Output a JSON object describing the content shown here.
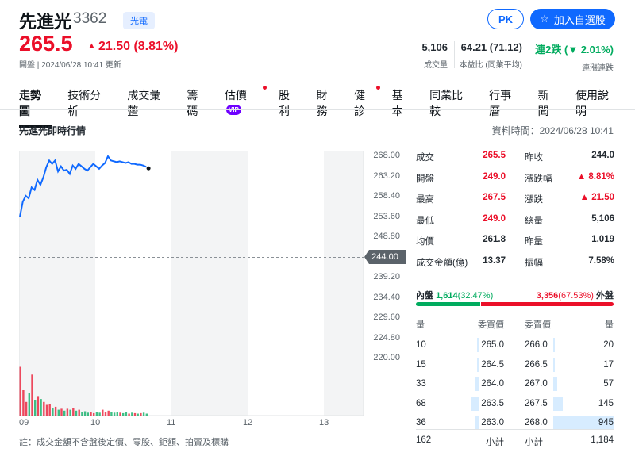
{
  "stock": {
    "name": "先進光",
    "code": "3362",
    "industry_tag": "光電",
    "price": "265.5",
    "change": "21.50 (8.81%)",
    "meta": "開盤 | 2024/06/28 10:41 更新"
  },
  "buttons": {
    "pk": "PK",
    "add_watchlist": "加入自選股"
  },
  "kpis": [
    {
      "value": "5,106",
      "label": "成交量"
    },
    {
      "value": "64.21 (71.12)",
      "label": "本益比 (同業平均)"
    },
    {
      "value": "連2跌 (▼ 2.01%)",
      "label": "連漲連跌"
    }
  ],
  "tabs": [
    {
      "label": "走勢圖",
      "active": true
    },
    {
      "label": "技術分析"
    },
    {
      "label": "成交彙整"
    },
    {
      "label": "籌碼"
    },
    {
      "label": "估價",
      "badge": "VIP",
      "dot": true
    },
    {
      "label": "股利"
    },
    {
      "label": "財務"
    },
    {
      "label": "健診",
      "dot": true
    },
    {
      "label": "基本"
    },
    {
      "label": "同業比較"
    },
    {
      "label": "行事曆"
    },
    {
      "label": "新聞"
    },
    {
      "label": "使用說明"
    }
  ],
  "section": {
    "title": "先進光即時行情",
    "data_time": "資料時間：2024/06/28 10:41"
  },
  "chart_data": {
    "type": "line",
    "y_ticks": [
      "268.00",
      "263.20",
      "258.40",
      "253.60",
      "248.80",
      "244.00",
      "239.20",
      "234.40",
      "229.60",
      "224.80",
      "220.00"
    ],
    "ylim": [
      220.0,
      268.0
    ],
    "reference_price": 244.0,
    "reference_label": "244.00",
    "x_ticks": [
      "09",
      "10",
      "11",
      "12",
      "13"
    ],
    "price_series": [
      253.6,
      257.2,
      258.6,
      258.0,
      260.6,
      260.0,
      262.4,
      261.2,
      263.0,
      265.4,
      267.0,
      266.2,
      267.0,
      264.4,
      265.6,
      264.6,
      264.8,
      263.8,
      265.8,
      265.0,
      266.2,
      265.6,
      265.0,
      264.6,
      265.4,
      266.2,
      265.6,
      265.0,
      265.8,
      266.4,
      268.0,
      267.0,
      266.8,
      266.6,
      266.8,
      266.6,
      266.4,
      266.6,
      266.2,
      266.2,
      266.0,
      266.0,
      265.8,
      265.5
    ],
    "volume_series": [
      500,
      260,
      140,
      230,
      420,
      160,
      200,
      170,
      140,
      110,
      120,
      80,
      90,
      60,
      70,
      50,
      70,
      60,
      80,
      50,
      60,
      40,
      45,
      30,
      40,
      25,
      35,
      30,
      60,
      40,
      50,
      35,
      30,
      40,
      30,
      25,
      35,
      20,
      30,
      25,
      20,
      25,
      30,
      20
    ],
    "volume_max": 520
  },
  "stats": {
    "left": [
      {
        "label": "成交",
        "value": "265.5",
        "color": "#eb0f29"
      },
      {
        "label": "開盤",
        "value": "249.0",
        "color": "#eb0f29"
      },
      {
        "label": "最高",
        "value": "267.5",
        "color": "#eb0f29"
      },
      {
        "label": "最低",
        "value": "249.0",
        "color": "#eb0f29"
      },
      {
        "label": "均價",
        "value": "261.8",
        "color": "#232a31"
      },
      {
        "label": "成交金額(億)",
        "value": "13.37",
        "color": "#232a31"
      }
    ],
    "right": [
      {
        "label": "昨收",
        "value": "244.0",
        "color": "#232a31"
      },
      {
        "label": "漲跌幅",
        "value": "▲ 8.81%",
        "color": "#eb0f29"
      },
      {
        "label": "漲跌",
        "value": "▲ 21.50",
        "color": "#eb0f29"
      },
      {
        "label": "總量",
        "value": "5,106",
        "color": "#232a31"
      },
      {
        "label": "昨量",
        "value": "1,019",
        "color": "#232a31"
      },
      {
        "label": "振幅",
        "value": "7.58%",
        "color": "#232a31"
      }
    ]
  },
  "orderbook": {
    "inner_label": "內盤",
    "inner_value": "1,614",
    "inner_pct": "(32.47%)",
    "inner_fraction": 0.3247,
    "outer_value": "3,356",
    "outer_pct": "(67.53%)",
    "outer_label": "外盤",
    "headers": [
      "量",
      "委買價",
      "委賣價",
      "量"
    ],
    "bids": [
      {
        "qty": "10",
        "price": "265.0",
        "qty_num": 10
      },
      {
        "qty": "15",
        "price": "264.5",
        "qty_num": 15
      },
      {
        "qty": "33",
        "price": "264.0",
        "qty_num": 33
      },
      {
        "qty": "68",
        "price": "263.5",
        "qty_num": 68
      },
      {
        "qty": "36",
        "price": "263.0",
        "qty_num": 36
      }
    ],
    "asks": [
      {
        "price": "266.0",
        "qty": "20",
        "qty_num": 20
      },
      {
        "price": "266.5",
        "qty": "17",
        "qty_num": 17
      },
      {
        "price": "267.0",
        "qty": "57",
        "qty_num": 57
      },
      {
        "price": "267.5",
        "qty": "145",
        "qty_num": 145
      },
      {
        "price": "268.0",
        "qty": "945",
        "qty_num": 945
      }
    ],
    "bid_total": "162",
    "subtotal_label": "小計",
    "ask_total": "1,184"
  },
  "note": "註：成交金額不含盤後定價、零股、鉅額、拍賣及標購",
  "colors": {
    "up": "#eb0f29",
    "down": "#00ab5e",
    "accent": "#0f69ff",
    "line": "#0f69ff"
  }
}
